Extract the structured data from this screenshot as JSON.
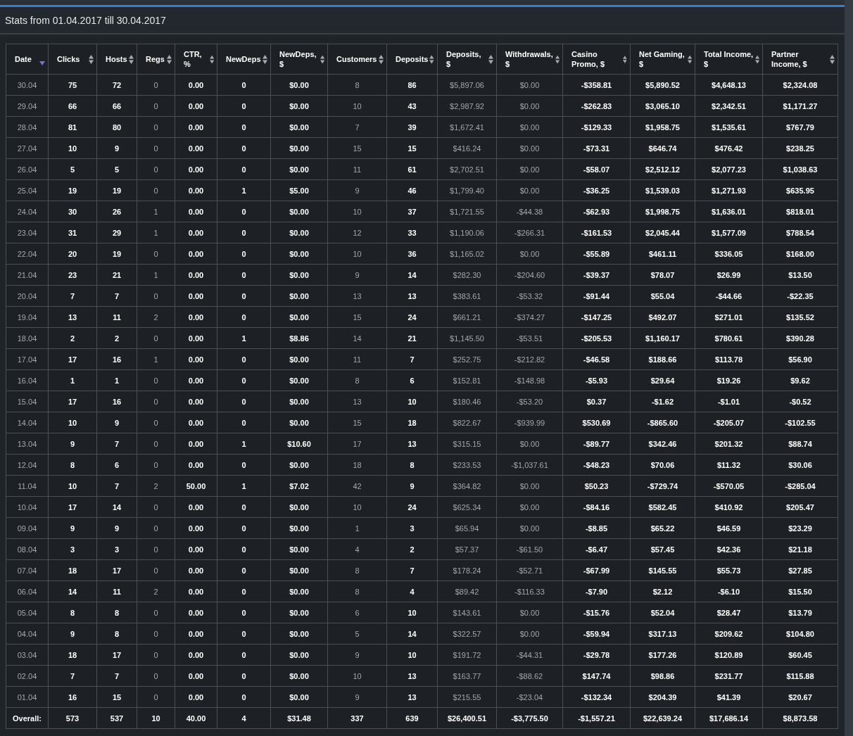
{
  "panel": {
    "title": "Stats from 01.04.2017 till 30.04.2017"
  },
  "table": {
    "columns": [
      {
        "label": "Date",
        "kind": "muted",
        "sorted": true
      },
      {
        "label": "Clicks",
        "kind": "bold",
        "sorted": false
      },
      {
        "label": "Hosts",
        "kind": "bold",
        "sorted": false
      },
      {
        "label": "Regs",
        "kind": "muted",
        "sorted": false
      },
      {
        "label": "CTR, %",
        "kind": "bold",
        "sorted": false
      },
      {
        "label": "NewDeps",
        "kind": "bold",
        "sorted": false
      },
      {
        "label": "NewDeps, $",
        "kind": "bold",
        "sorted": false
      },
      {
        "label": "Customers",
        "kind": "muted",
        "sorted": false
      },
      {
        "label": "Deposits",
        "kind": "bold",
        "sorted": false
      },
      {
        "label": "Deposits, $",
        "kind": "muted",
        "sorted": false
      },
      {
        "label": "Withdrawals, $",
        "kind": "muted",
        "sorted": false
      },
      {
        "label": "Casino Promo, $",
        "kind": "bold",
        "sorted": false
      },
      {
        "label": "Net Gaming, $",
        "kind": "bold",
        "sorted": false
      },
      {
        "label": "Total Income, $",
        "kind": "bold",
        "sorted": false
      },
      {
        "label": "Partner Income, $",
        "kind": "bold",
        "sorted": false
      }
    ],
    "rows": [
      [
        "30.04",
        "75",
        "72",
        "0",
        "0.00",
        "0",
        "$0.00",
        "8",
        "86",
        "$5,897.06",
        "$0.00",
        "-$358.81",
        "$5,890.52",
        "$4,648.13",
        "$2,324.08"
      ],
      [
        "29.04",
        "66",
        "66",
        "0",
        "0.00",
        "0",
        "$0.00",
        "10",
        "43",
        "$2,987.92",
        "$0.00",
        "-$262.83",
        "$3,065.10",
        "$2,342.51",
        "$1,171.27"
      ],
      [
        "28.04",
        "81",
        "80",
        "0",
        "0.00",
        "0",
        "$0.00",
        "7",
        "39",
        "$1,672.41",
        "$0.00",
        "-$129.33",
        "$1,958.75",
        "$1,535.61",
        "$767.79"
      ],
      [
        "27.04",
        "10",
        "9",
        "0",
        "0.00",
        "0",
        "$0.00",
        "15",
        "15",
        "$416.24",
        "$0.00",
        "-$73.31",
        "$646.74",
        "$476.42",
        "$238.25"
      ],
      [
        "26.04",
        "5",
        "5",
        "0",
        "0.00",
        "0",
        "$0.00",
        "11",
        "61",
        "$2,702.51",
        "$0.00",
        "-$58.07",
        "$2,512.12",
        "$2,077.23",
        "$1,038.63"
      ],
      [
        "25.04",
        "19",
        "19",
        "0",
        "0.00",
        "1",
        "$5.00",
        "9",
        "46",
        "$1,799.40",
        "$0.00",
        "-$36.25",
        "$1,539.03",
        "$1,271.93",
        "$635.95"
      ],
      [
        "24.04",
        "30",
        "26",
        "1",
        "0.00",
        "0",
        "$0.00",
        "10",
        "37",
        "$1,721.55",
        "-$44.38",
        "-$62.93",
        "$1,998.75",
        "$1,636.01",
        "$818.01"
      ],
      [
        "23.04",
        "31",
        "29",
        "1",
        "0.00",
        "0",
        "$0.00",
        "12",
        "33",
        "$1,190.06",
        "-$266.31",
        "-$161.53",
        "$2,045.44",
        "$1,577.09",
        "$788.54"
      ],
      [
        "22.04",
        "20",
        "19",
        "0",
        "0.00",
        "0",
        "$0.00",
        "10",
        "36",
        "$1,165.02",
        "$0.00",
        "-$55.89",
        "$461.11",
        "$336.05",
        "$168.00"
      ],
      [
        "21.04",
        "23",
        "21",
        "1",
        "0.00",
        "0",
        "$0.00",
        "9",
        "14",
        "$282.30",
        "-$204.60",
        "-$39.37",
        "$78.07",
        "$26.99",
        "$13.50"
      ],
      [
        "20.04",
        "7",
        "7",
        "0",
        "0.00",
        "0",
        "$0.00",
        "13",
        "13",
        "$383.61",
        "-$53.32",
        "-$91.44",
        "$55.04",
        "-$44.66",
        "-$22.35"
      ],
      [
        "19.04",
        "13",
        "11",
        "2",
        "0.00",
        "0",
        "$0.00",
        "15",
        "24",
        "$661.21",
        "-$374.27",
        "-$147.25",
        "$492.07",
        "$271.01",
        "$135.52"
      ],
      [
        "18.04",
        "2",
        "2",
        "0",
        "0.00",
        "1",
        "$8.86",
        "14",
        "21",
        "$1,145.50",
        "-$53.51",
        "-$205.53",
        "$1,160.17",
        "$780.61",
        "$390.28"
      ],
      [
        "17.04",
        "17",
        "16",
        "1",
        "0.00",
        "0",
        "$0.00",
        "11",
        "7",
        "$252.75",
        "-$212.82",
        "-$46.58",
        "$188.66",
        "$113.78",
        "$56.90"
      ],
      [
        "16.04",
        "1",
        "1",
        "0",
        "0.00",
        "0",
        "$0.00",
        "8",
        "6",
        "$152.81",
        "-$148.98",
        "-$5.93",
        "$29.64",
        "$19.26",
        "$9.62"
      ],
      [
        "15.04",
        "17",
        "16",
        "0",
        "0.00",
        "0",
        "$0.00",
        "13",
        "10",
        "$180.46",
        "-$53.20",
        "$0.37",
        "-$1.62",
        "-$1.01",
        "-$0.52"
      ],
      [
        "14.04",
        "10",
        "9",
        "0",
        "0.00",
        "0",
        "$0.00",
        "15",
        "18",
        "$822.67",
        "-$939.99",
        "$530.69",
        "-$865.60",
        "-$205.07",
        "-$102.55"
      ],
      [
        "13.04",
        "9",
        "7",
        "0",
        "0.00",
        "1",
        "$10.60",
        "17",
        "13",
        "$315.15",
        "$0.00",
        "-$89.77",
        "$342.46",
        "$201.32",
        "$88.74"
      ],
      [
        "12.04",
        "8",
        "6",
        "0",
        "0.00",
        "0",
        "$0.00",
        "18",
        "8",
        "$233.53",
        "-$1,037.61",
        "-$48.23",
        "$70.06",
        "$11.32",
        "$30.06"
      ],
      [
        "11.04",
        "10",
        "7",
        "2",
        "50.00",
        "1",
        "$7.02",
        "42",
        "9",
        "$364.82",
        "$0.00",
        "$50.23",
        "-$729.74",
        "-$570.05",
        "-$285.04"
      ],
      [
        "10.04",
        "17",
        "14",
        "0",
        "0.00",
        "0",
        "$0.00",
        "10",
        "24",
        "$625.34",
        "$0.00",
        "-$84.16",
        "$582.45",
        "$410.92",
        "$205.47"
      ],
      [
        "09.04",
        "9",
        "9",
        "0",
        "0.00",
        "0",
        "$0.00",
        "1",
        "3",
        "$65.94",
        "$0.00",
        "-$8.85",
        "$65.22",
        "$46.59",
        "$23.29"
      ],
      [
        "08.04",
        "3",
        "3",
        "0",
        "0.00",
        "0",
        "$0.00",
        "4",
        "2",
        "$57.37",
        "-$61.50",
        "-$6.47",
        "$57.45",
        "$42.36",
        "$21.18"
      ],
      [
        "07.04",
        "18",
        "17",
        "0",
        "0.00",
        "0",
        "$0.00",
        "8",
        "7",
        "$178.24",
        "-$52.71",
        "-$67.99",
        "$145.55",
        "$55.73",
        "$27.85"
      ],
      [
        "06.04",
        "14",
        "11",
        "2",
        "0.00",
        "0",
        "$0.00",
        "8",
        "4",
        "$89.42",
        "-$116.33",
        "-$7.90",
        "$2.12",
        "-$6.10",
        "$15.50"
      ],
      [
        "05.04",
        "8",
        "8",
        "0",
        "0.00",
        "0",
        "$0.00",
        "6",
        "10",
        "$143.61",
        "$0.00",
        "-$15.76",
        "$52.04",
        "$28.47",
        "$13.79"
      ],
      [
        "04.04",
        "9",
        "8",
        "0",
        "0.00",
        "0",
        "$0.00",
        "5",
        "14",
        "$322.57",
        "$0.00",
        "-$59.94",
        "$317.13",
        "$209.62",
        "$104.80"
      ],
      [
        "03.04",
        "18",
        "17",
        "0",
        "0.00",
        "0",
        "$0.00",
        "9",
        "10",
        "$191.72",
        "-$44.31",
        "-$29.78",
        "$177.26",
        "$120.89",
        "$60.45"
      ],
      [
        "02.04",
        "7",
        "7",
        "0",
        "0.00",
        "0",
        "$0.00",
        "10",
        "13",
        "$163.77",
        "-$88.62",
        "$147.74",
        "$98.86",
        "$231.77",
        "$115.88"
      ],
      [
        "01.04",
        "16",
        "15",
        "0",
        "0.00",
        "0",
        "$0.00",
        "9",
        "13",
        "$215.55",
        "-$23.04",
        "-$132.34",
        "$204.39",
        "$41.39",
        "$20.67"
      ]
    ],
    "totals": [
      "Overall:",
      "573",
      "537",
      "10",
      "40.00",
      "4",
      "$31.48",
      "337",
      "639",
      "$26,400.51",
      "-$3,775.50",
      "-$1,557.21",
      "$22,639.24",
      "$17,686.14",
      "$8,873.58"
    ]
  }
}
